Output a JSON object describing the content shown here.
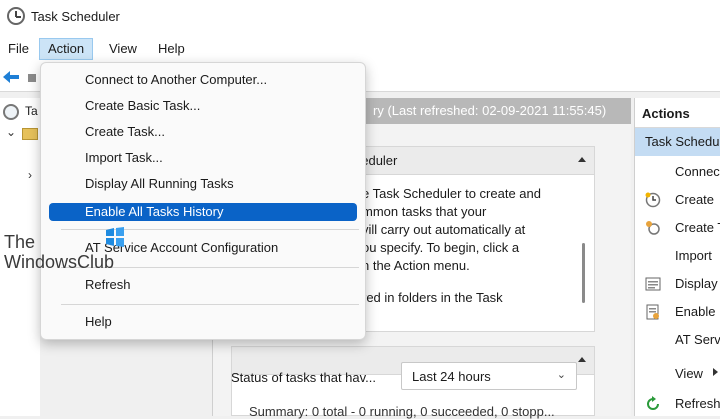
{
  "window": {
    "title": "Task Scheduler"
  },
  "menubar": {
    "items": [
      {
        "label": "File"
      },
      {
        "label": "Action",
        "active": true
      },
      {
        "label": "View"
      },
      {
        "label": "Help"
      }
    ]
  },
  "tree": {
    "root_label": "Ta"
  },
  "center": {
    "header_text": "ry (Last refreshed: 02-09-2021 11:55:45)",
    "section1": {
      "title": "heduler",
      "lines": [
        "e Task Scheduler to create and",
        "mmon tasks that your",
        "vill carry out automatically at",
        "ou specify. To begin, click a",
        "n the Action menu.",
        "",
        "red in folders in the Task"
      ]
    },
    "status_label": "Status of tasks that hav...",
    "status_select": "Last 24 hours",
    "summary": "Summary: 0 total - 0 running, 0 succeeded, 0 stopp..."
  },
  "actions": {
    "header": "Actions",
    "sub_header": "Task Schedu",
    "items": [
      {
        "label": "Connec",
        "icon": "connect-icon"
      },
      {
        "label": "Create",
        "icon": "create-basic-task-icon"
      },
      {
        "label": "Create T",
        "icon": "create-task-icon"
      },
      {
        "label": "Import",
        "icon": "import-icon"
      },
      {
        "label": "Display",
        "icon": "display-running-icon"
      },
      {
        "label": "Enable",
        "icon": "enable-history-icon"
      },
      {
        "label": "AT Serv",
        "icon": "none"
      },
      {
        "label": "View",
        "icon": "none"
      },
      {
        "label": "Refresh",
        "icon": "refresh-icon"
      }
    ]
  },
  "action_menu": {
    "items": [
      {
        "label": "Connect to Another Computer..."
      },
      {
        "label": "Create Basic Task..."
      },
      {
        "label": "Create Task..."
      },
      {
        "label": "Import Task..."
      },
      {
        "label": "Display All Running Tasks"
      },
      {
        "label": "Enable All Tasks History",
        "highlighted": true
      },
      {
        "label": "AT Service Account Configuration"
      },
      {
        "label": "Refresh"
      },
      {
        "label": "Help"
      }
    ]
  },
  "watermark": {
    "line1": "The",
    "line2": "WindowsClub"
  },
  "colors": {
    "highlight": "#0a63c7",
    "menu_active": "#cce4f7",
    "actions_sub": "#c4dcf3",
    "center_header": "#b8b8b8"
  }
}
